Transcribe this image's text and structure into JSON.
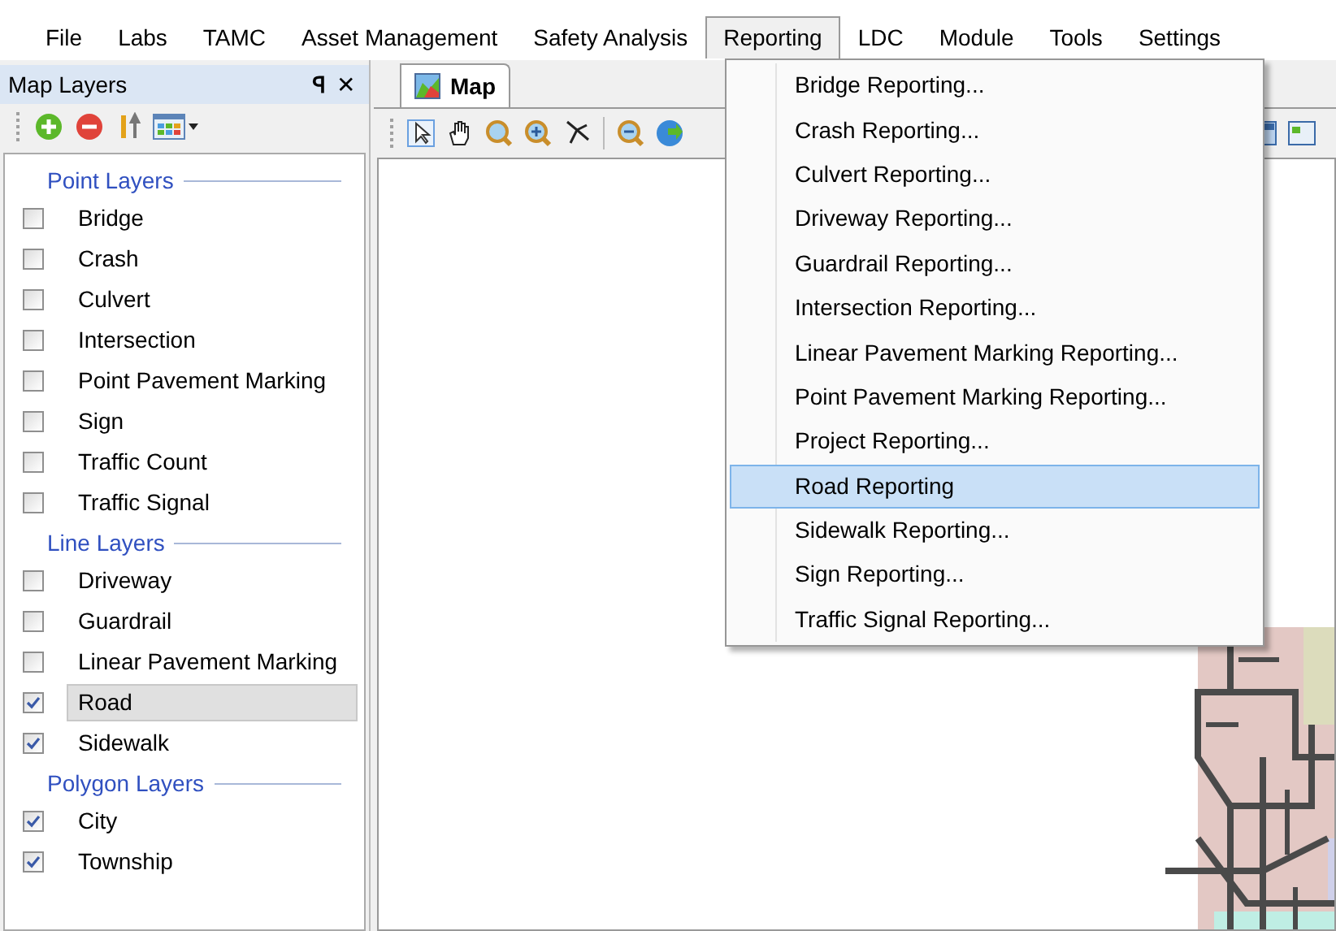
{
  "menu_bar": [
    {
      "label": "File",
      "selected": false
    },
    {
      "label": "Labs",
      "selected": false
    },
    {
      "label": "TAMC",
      "selected": false
    },
    {
      "label": "Asset Management",
      "selected": false
    },
    {
      "label": "Safety Analysis",
      "selected": false
    },
    {
      "label": "Reporting",
      "selected": true
    },
    {
      "label": "LDC",
      "selected": false
    },
    {
      "label": "Module",
      "selected": false
    },
    {
      "label": "Tools",
      "selected": false
    },
    {
      "label": "Settings",
      "selected": false
    }
  ],
  "map_layers": {
    "title": "Map Layers",
    "pin": "ꟼ",
    "close": "✕",
    "groups": [
      {
        "title": "Point Layers",
        "items": [
          {
            "label": "Bridge",
            "checked": false,
            "selected": false
          },
          {
            "label": "Crash",
            "checked": false,
            "selected": false
          },
          {
            "label": "Culvert",
            "checked": false,
            "selected": false
          },
          {
            "label": "Intersection",
            "checked": false,
            "selected": false
          },
          {
            "label": "Point Pavement Marking",
            "checked": false,
            "selected": false
          },
          {
            "label": "Sign",
            "checked": false,
            "selected": false
          },
          {
            "label": "Traffic Count",
            "checked": false,
            "selected": false
          },
          {
            "label": "Traffic Signal",
            "checked": false,
            "selected": false
          }
        ]
      },
      {
        "title": "Line Layers",
        "items": [
          {
            "label": "Driveway",
            "checked": false,
            "selected": false
          },
          {
            "label": "Guardrail",
            "checked": false,
            "selected": false
          },
          {
            "label": "Linear Pavement Marking",
            "checked": false,
            "selected": false
          },
          {
            "label": "Road",
            "checked": true,
            "selected": true
          },
          {
            "label": "Sidewalk",
            "checked": true,
            "selected": false
          }
        ]
      },
      {
        "title": "Polygon Layers",
        "items": [
          {
            "label": "City",
            "checked": true,
            "selected": false
          },
          {
            "label": "Township",
            "checked": true,
            "selected": false
          }
        ]
      }
    ]
  },
  "map_tab": {
    "label": "Map"
  },
  "reporting_menu": [
    {
      "label": "Bridge Reporting...",
      "selected": false
    },
    {
      "label": "Crash Reporting...",
      "selected": false
    },
    {
      "label": "Culvert Reporting...",
      "selected": false
    },
    {
      "label": "Driveway Reporting...",
      "selected": false
    },
    {
      "label": "Guardrail Reporting...",
      "selected": false
    },
    {
      "label": "Intersection Reporting...",
      "selected": false
    },
    {
      "label": "Linear Pavement Marking Reporting...",
      "selected": false
    },
    {
      "label": "Point Pavement Marking Reporting...",
      "selected": false
    },
    {
      "label": "Project Reporting...",
      "selected": false
    },
    {
      "label": "Road Reporting",
      "selected": true
    },
    {
      "label": "Sidewalk Reporting...",
      "selected": false
    },
    {
      "label": "Sign Reporting...",
      "selected": false
    },
    {
      "label": "Traffic Signal Reporting...",
      "selected": false
    }
  ]
}
